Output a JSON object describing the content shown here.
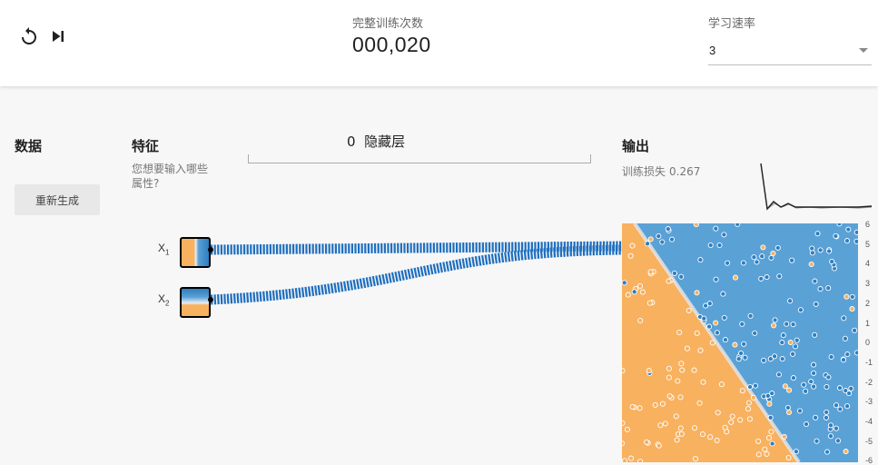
{
  "controls": {
    "reset_icon": "reset-icon",
    "step_icon": "step-icon"
  },
  "epoch": {
    "label": "完整训练次数",
    "value": "000,020"
  },
  "learning_rate": {
    "label": "学习速率",
    "selected": "3"
  },
  "data_section": {
    "title": "数据",
    "regenerate_label": "重新生成"
  },
  "features_section": {
    "title": "特征",
    "question_line1": "您想要输入哪些",
    "question_line2": "属性?",
    "x1_label": "X",
    "x1_sub": "1",
    "x2_label": "X",
    "x2_sub": "2"
  },
  "hidden_layers": {
    "count": "0",
    "label": "隐藏层"
  },
  "output_section": {
    "title": "输出",
    "train_loss_label": "训练损失",
    "train_loss_value": "0.267"
  },
  "axis_ticks": [
    "6",
    "5",
    "4",
    "3",
    "2",
    "1",
    "0",
    "-1",
    "-2",
    "-3",
    "-4",
    "-5",
    "-6"
  ],
  "colors": {
    "positive": "#2d7fc1",
    "negative": "#f8b15f",
    "region_blue": "#5aa1d6",
    "region_orange": "#f8b15f"
  }
}
